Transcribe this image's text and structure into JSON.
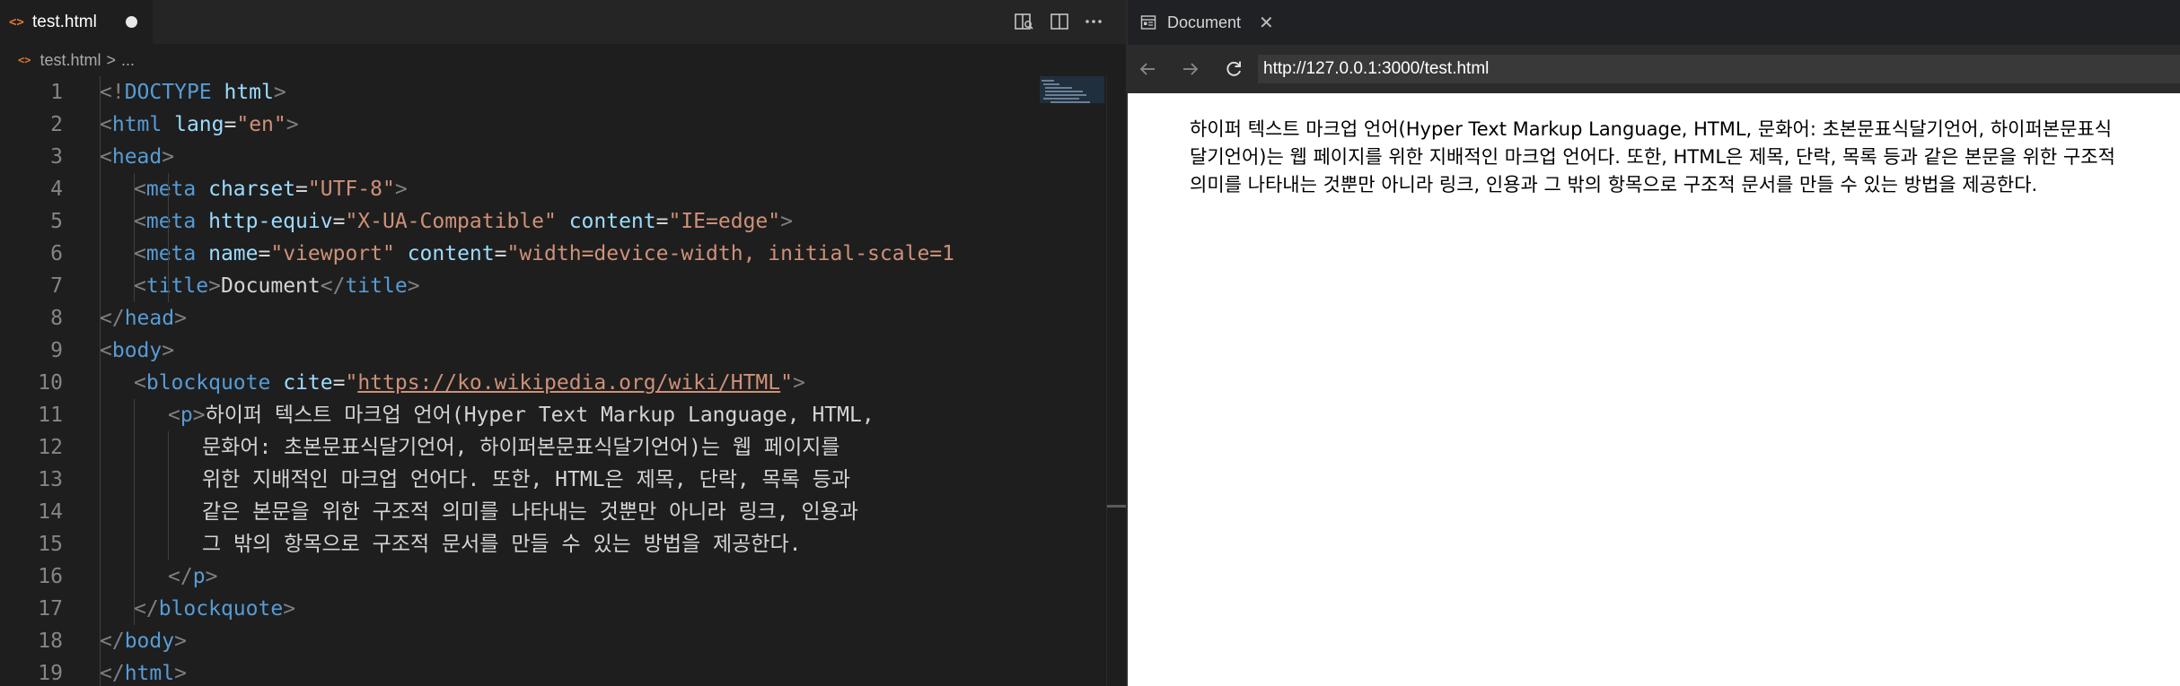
{
  "editor": {
    "tab": {
      "icon": "html-file-icon",
      "filename": "test.html",
      "modified": true
    },
    "toolbar": [
      "open-preview-to-side-icon",
      "split-editor-icon",
      "more-actions-icon"
    ],
    "breadcrumb": {
      "filename": "test.html",
      "separator": ">",
      "more": "..."
    },
    "lines": [
      {
        "n": "1",
        "indent": 0,
        "tokens": [
          {
            "t": "<!",
            "c": "br"
          },
          {
            "t": "DOCTYPE",
            "c": "tag"
          },
          {
            "t": " html",
            "c": "attr"
          },
          {
            "t": ">",
            "c": "br"
          }
        ]
      },
      {
        "n": "2",
        "indent": 0,
        "tokens": [
          {
            "t": "<",
            "c": "br"
          },
          {
            "t": "html",
            "c": "tag"
          },
          {
            "t": " lang",
            "c": "attr"
          },
          {
            "t": "=",
            "c": "txt"
          },
          {
            "t": "\"en\"",
            "c": "str"
          },
          {
            "t": ">",
            "c": "br"
          }
        ]
      },
      {
        "n": "3",
        "indent": 0,
        "tokens": [
          {
            "t": "<",
            "c": "br"
          },
          {
            "t": "head",
            "c": "tag"
          },
          {
            "t": ">",
            "c": "br"
          }
        ]
      },
      {
        "n": "4",
        "indent": 1,
        "tokens": [
          {
            "t": "<",
            "c": "br"
          },
          {
            "t": "meta",
            "c": "tag"
          },
          {
            "t": " charset",
            "c": "attr"
          },
          {
            "t": "=",
            "c": "txt"
          },
          {
            "t": "\"UTF-8\"",
            "c": "str"
          },
          {
            "t": ">",
            "c": "br"
          }
        ]
      },
      {
        "n": "5",
        "indent": 1,
        "tokens": [
          {
            "t": "<",
            "c": "br"
          },
          {
            "t": "meta",
            "c": "tag"
          },
          {
            "t": " http-equiv",
            "c": "attr"
          },
          {
            "t": "=",
            "c": "txt"
          },
          {
            "t": "\"X-UA-Compatible\"",
            "c": "str"
          },
          {
            "t": " content",
            "c": "attr"
          },
          {
            "t": "=",
            "c": "txt"
          },
          {
            "t": "\"IE=edge\"",
            "c": "str"
          },
          {
            "t": ">",
            "c": "br"
          }
        ]
      },
      {
        "n": "6",
        "indent": 1,
        "tokens": [
          {
            "t": "<",
            "c": "br"
          },
          {
            "t": "meta",
            "c": "tag"
          },
          {
            "t": " name",
            "c": "attr"
          },
          {
            "t": "=",
            "c": "txt"
          },
          {
            "t": "\"viewport\"",
            "c": "str"
          },
          {
            "t": " content",
            "c": "attr"
          },
          {
            "t": "=",
            "c": "txt"
          },
          {
            "t": "\"width=device-width, initial-scale=1",
            "c": "str"
          }
        ]
      },
      {
        "n": "7",
        "indent": 1,
        "tokens": [
          {
            "t": "<",
            "c": "br"
          },
          {
            "t": "title",
            "c": "tag"
          },
          {
            "t": ">",
            "c": "br"
          },
          {
            "t": "Document",
            "c": "txt"
          },
          {
            "t": "</",
            "c": "br"
          },
          {
            "t": "title",
            "c": "tag"
          },
          {
            "t": ">",
            "c": "br"
          }
        ]
      },
      {
        "n": "8",
        "indent": 0,
        "tokens": [
          {
            "t": "</",
            "c": "br"
          },
          {
            "t": "head",
            "c": "tag"
          },
          {
            "t": ">",
            "c": "br"
          }
        ]
      },
      {
        "n": "9",
        "indent": 0,
        "tokens": [
          {
            "t": "<",
            "c": "br"
          },
          {
            "t": "body",
            "c": "tag"
          },
          {
            "t": ">",
            "c": "br"
          }
        ]
      },
      {
        "n": "10",
        "indent": 1,
        "tokens": [
          {
            "t": "<",
            "c": "br"
          },
          {
            "t": "blockquote",
            "c": "tag"
          },
          {
            "t": " cite",
            "c": "attr"
          },
          {
            "t": "=",
            "c": "txt"
          },
          {
            "t": "\"",
            "c": "str"
          },
          {
            "t": "https://ko.wikipedia.org/wiki/HTML",
            "c": "url"
          },
          {
            "t": "\"",
            "c": "str"
          },
          {
            "t": ">",
            "c": "br"
          }
        ]
      },
      {
        "n": "11",
        "indent": 2,
        "tokens": [
          {
            "t": "<",
            "c": "br"
          },
          {
            "t": "p",
            "c": "tag"
          },
          {
            "t": ">",
            "c": "br"
          },
          {
            "t": "하이퍼 텍스트 마크업 언어(Hyper Text Markup Language, HTML,",
            "c": "txt"
          }
        ]
      },
      {
        "n": "12",
        "indent": 3,
        "tokens": [
          {
            "t": "문화어: 초본문표식달기언어, 하이퍼본문표식달기언어)는 웹 페이지를",
            "c": "txt"
          }
        ]
      },
      {
        "n": "13",
        "indent": 3,
        "tokens": [
          {
            "t": "위한 지배적인 마크업 언어다. 또한, HTML은 제목, 단락, 목록 등과",
            "c": "txt"
          }
        ]
      },
      {
        "n": "14",
        "indent": 3,
        "tokens": [
          {
            "t": "같은 본문을 위한 구조적 의미를 나타내는 것뿐만 아니라 링크, 인용과",
            "c": "txt"
          }
        ]
      },
      {
        "n": "15",
        "indent": 3,
        "tokens": [
          {
            "t": "그 밖의 항목으로 구조적 문서를 만들 수 있는 방법을 제공한다.",
            "c": "txt"
          }
        ]
      },
      {
        "n": "16",
        "indent": 2,
        "tokens": [
          {
            "t": "</",
            "c": "br"
          },
          {
            "t": "p",
            "c": "tag"
          },
          {
            "t": ">",
            "c": "br"
          }
        ]
      },
      {
        "n": "17",
        "indent": 1,
        "tokens": [
          {
            "t": "</",
            "c": "br"
          },
          {
            "t": "blockquote",
            "c": "tag"
          },
          {
            "t": ">",
            "c": "br"
          }
        ]
      },
      {
        "n": "18",
        "indent": 0,
        "tokens": [
          {
            "t": "</",
            "c": "br"
          },
          {
            "t": "body",
            "c": "tag"
          },
          {
            "t": ">",
            "c": "br"
          }
        ]
      },
      {
        "n": "19",
        "indent": 0,
        "tokens": [
          {
            "t": "</",
            "c": "br"
          },
          {
            "t": "html",
            "c": "tag"
          },
          {
            "t": ">",
            "c": "br"
          }
        ]
      }
    ],
    "colors": {
      "tag": "#569cd6",
      "bracket": "#808080",
      "attr": "#9cdcfe",
      "string": "#ce9178",
      "text": "#d4d4d4",
      "line_number": "#858585",
      "background": "#1e1e1e"
    }
  },
  "browser": {
    "tab": {
      "icon": "document-icon",
      "title": "Document",
      "close_icon": "close-icon"
    },
    "nav": {
      "back_icon": "back-arrow-icon",
      "forward_icon": "forward-arrow-icon",
      "reload_icon": "reload-icon"
    },
    "url": "http://127.0.0.1:3000/test.html",
    "content": {
      "paragraph": "하이퍼 텍스트 마크업 언어(Hyper Text Markup Language, HTML, 문화어: 초본문표식달기언어, 하이퍼본문표식달기언어)는 웹 페이지를 위한 지배적인 마크업 언어다. 또한, HTML은 제목, 단락, 목록 등과 같은 본문을 위한 구조적 의미를 나타내는 것뿐만 아니라 링크, 인용과 그 밖의 항목으로 구조적 문서를 만들 수 있는 방법을 제공한다."
    }
  }
}
